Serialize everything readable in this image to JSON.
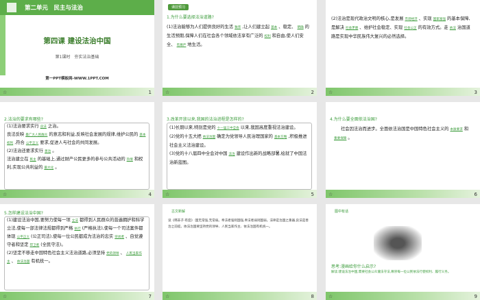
{
  "slides": [
    {
      "num": "1",
      "unit": "第二单元　民主与法治",
      "title": "第四课 建设法治中国",
      "sub": "第1课时　夯实法治基础",
      "footer": "第一PPT模板网-WWW.1PPT.COM"
    },
    {
      "num": "2",
      "badge": "课前预习",
      "q": "1.为什么要选择法治道路?",
      "p1": "(1)法治能够为人们提供良好的生活",
      "a1": "秩序",
      "p2": ",让人们建立起",
      "a2": "基本",
      "p3": "、稳定、",
      "a3": "明确",
      "p4": "的生活预期,保障人们在社会各个领域依法享有广泛的",
      "a4": "权利",
      "p5": "和自由,使人们安全、",
      "a5": "有尊严",
      "p6": "地生活。"
    },
    {
      "num": "3",
      "p1": "(2)法治是现代政治文明的核心,是发展",
      "a1": "市场经济",
      "p2": "、实现",
      "a2": "国家富强",
      "p3": "的基本保障,是解决",
      "a3": "社会矛盾",
      "p4": "、维护社会稳定、实现",
      "a4": "社会公正",
      "p5": "的有效方式。走",
      "a5": "依法",
      "p6": "治国道路是实现中华民族伟大复兴的必然选择。"
    },
    {
      "num": "4",
      "q": "2.法治的要求有哪些?",
      "p1": "(1)法治要求实行",
      "a1": "良法",
      "p2": "之治。",
      "p3": "良法反映",
      "a3": "最广大人民群众",
      "p4": "的意志和利益,反映社会发展的规律,维护公民的",
      "a4": "基本权利",
      "p5": ",符合",
      "a5": "公平正义",
      "p6": "要求,促进人与社会的共同发展。",
      "p7": "(2)法治还要求实行",
      "a7": "善治",
      "p8": "。",
      "p9": "法治建立在",
      "a9": "民主",
      "p10": "的基础上,通过财产公民更多的参与公共活动的",
      "a10": "热情",
      "p11": "和权利,实现公共利益的",
      "a11": "最大化",
      "p12": "。"
    },
    {
      "num": "5",
      "q": "3.改革开放以来,我国的法治进程是怎样的?",
      "p1": "(1)长期以来,特别是党的",
      "a1": "十一届三中全会",
      "p2": "以来,我国高度重视法治建设。",
      "p3": "(2)党的十五大把",
      "a3": "依法治国",
      "p4": "确定为党领导人民治理国家的",
      "a4": "基本方略",
      "p5": ",积极推进社会主义法治建设。",
      "p6": "(3)党的十八届四中全会对中国",
      "a6": "法治",
      "p7": "建设作出新的战略部署,绘就了中国法治新蓝图。"
    },
    {
      "num": "6",
      "q": "4.为什么要全面依法治国?",
      "p1": "社会因法治而进步。全面依法治国是中国特色社会主义的",
      "a1": "本质要求",
      "p2": "和",
      "a2": "重要保障",
      "p3": "。"
    },
    {
      "num": "7",
      "q": "5.怎样建设法治中国?",
      "p1": "(1)建设法治中国,要努力使每一项",
      "a1": "立法",
      "p2": "都得到人民群众的普遍拥护和科学立法,使每一部法律法规都得到严格",
      "a2": "执行",
      "p3": "(严格执法),使每一个司法案件都体现",
      "a3": "公平正义",
      "p4": "(公正司法),使每一位公民都成为法治的忠实",
      "a4": "崇尚者",
      "p5": "、自觉遵守者和坚定",
      "a5": "捍卫者",
      "p6": "(全民守法)。",
      "p7": "(2)坚定不移走中国特色社会主义法治道路,必须坚持",
      "a7": "党的领导",
      "p8": "、",
      "a8": "人民当家作主",
      "p9": "、",
      "a9": "依法治国",
      "p10": "有机统一。"
    },
    {
      "num": "8",
      "badge": "古文新解",
      "body": "读《韩非子·有度》:国无常强,无常弱。奉法者强则国强,奉法者弱则国弱。法律是治国之重器,良法是善治之前提。依法治国要坚持党的领导、人民当家作主、依法治国有机统一。"
    },
    {
      "num": "9",
      "badge": "图中有话",
      "q": "思考:漫画给你什么启示?",
      "ans": "解读:建设法治中国,需要社会公众遵法守法,尊崇每一位公民依法行使权利、履行义务。"
    }
  ]
}
